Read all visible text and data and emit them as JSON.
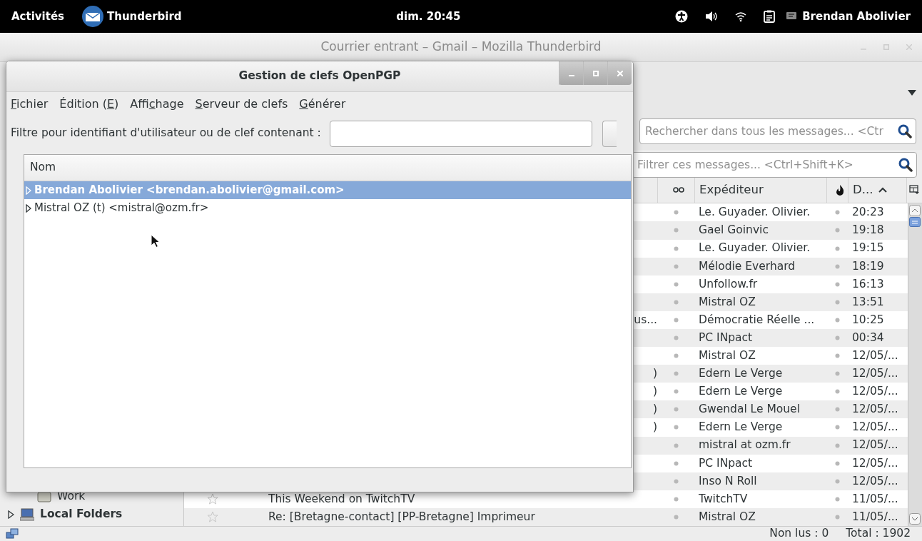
{
  "top_bar": {
    "activities": "Activités",
    "app": "Thunderbird",
    "clock": "dim. 20:45",
    "user": "Brendan Abolivier"
  },
  "main_window": {
    "title": "Courrier entrant – Gmail – Mozilla Thunderbird",
    "search": {
      "placeholder": "Rechercher dans tous les messages... <Ctr"
    },
    "quick_filter": {
      "placeholder": "Filtrer ces messages... <Ctrl+Shift+K>"
    },
    "folders": [
      {
        "kind": "folder",
        "label": "Work"
      },
      {
        "kind": "account",
        "label": "Local Folders",
        "expanded": false
      }
    ],
    "columns": [
      {
        "kind": "thread"
      },
      {
        "kind": "text",
        "label": "Expéditeur",
        "sorted": false
      },
      {
        "kind": "junk"
      },
      {
        "kind": "text",
        "label": "D...",
        "sorted": true
      },
      {
        "kind": "picker"
      }
    ],
    "messages": [
      {
        "sender": "Le. Guyader. Olivier.",
        "date": "20:23"
      },
      {
        "sender": "Gael Goinvic",
        "date": "19:18"
      },
      {
        "sender": "Le. Guyader. Olivier.",
        "date": "19:15"
      },
      {
        "sender": "Mélodie Everhard",
        "date": "18:19"
      },
      {
        "sender": "Unfollow.fr",
        "date": "16:13"
      },
      {
        "sender": "Mistral OZ",
        "date": "13:51"
      },
      {
        "subject_end": "us...",
        "sender": "Démocratie Réelle ...",
        "date": "10:25"
      },
      {
        "sender": "PC INpact",
        "date": "00:34"
      },
      {
        "sender": "Mistral OZ",
        "date": "12/05/..."
      },
      {
        "subject_end": ")",
        "sender": "Edern Le Verge",
        "date": "12/05/..."
      },
      {
        "subject_end": ")",
        "sender": "Edern Le Verge",
        "date": "12/05/..."
      },
      {
        "subject_end": ")",
        "sender": "Gwendal Le Mouel",
        "date": "12/05/..."
      },
      {
        "subject_end": ")",
        "sender": "Edern Le Verge",
        "date": "12/05/..."
      },
      {
        "sender": "mistral at ozm.fr",
        "date": "12/05/..."
      },
      {
        "sender": "PC INpact",
        "date": "12/05/..."
      },
      {
        "sender": "Inso N Roll",
        "date": "12/05/..."
      },
      {
        "starred": false,
        "subject": "This Weekend on TwitchTV",
        "sender": "TwitchTV",
        "date": "11/05/..."
      },
      {
        "starred": false,
        "subject": "Re: [Bretagne-contact] [PP-Bretagne] Imprimeur",
        "sender": "Mistral OZ",
        "date": "11/05/..."
      }
    ],
    "status": {
      "unread": "Non lus : 0",
      "total": "Total : 1902"
    }
  },
  "dialog": {
    "title": "Gestion de clefs OpenPGP",
    "menu": [
      {
        "key": "F",
        "after": "ichier"
      },
      {
        "before": "Édition (",
        "key": "E",
        "after": ")"
      },
      {
        "before": "Affi",
        "key": "c",
        "after": "hage"
      },
      {
        "key": "S",
        "after": "erveur de clefs"
      },
      {
        "key": "G",
        "after": "énérer"
      }
    ],
    "filter_label": "Filtre pour identifiant d'utilisateur ou de clef contenant :",
    "column": "Nom",
    "keys": [
      {
        "label": "Brendan Abolivier <brendan.abolivier@gmail.com>",
        "selected": true,
        "expanded": false
      },
      {
        "label": "Mistral OZ (t) <mistral@ozm.fr>",
        "selected": false,
        "expanded": false
      }
    ]
  }
}
